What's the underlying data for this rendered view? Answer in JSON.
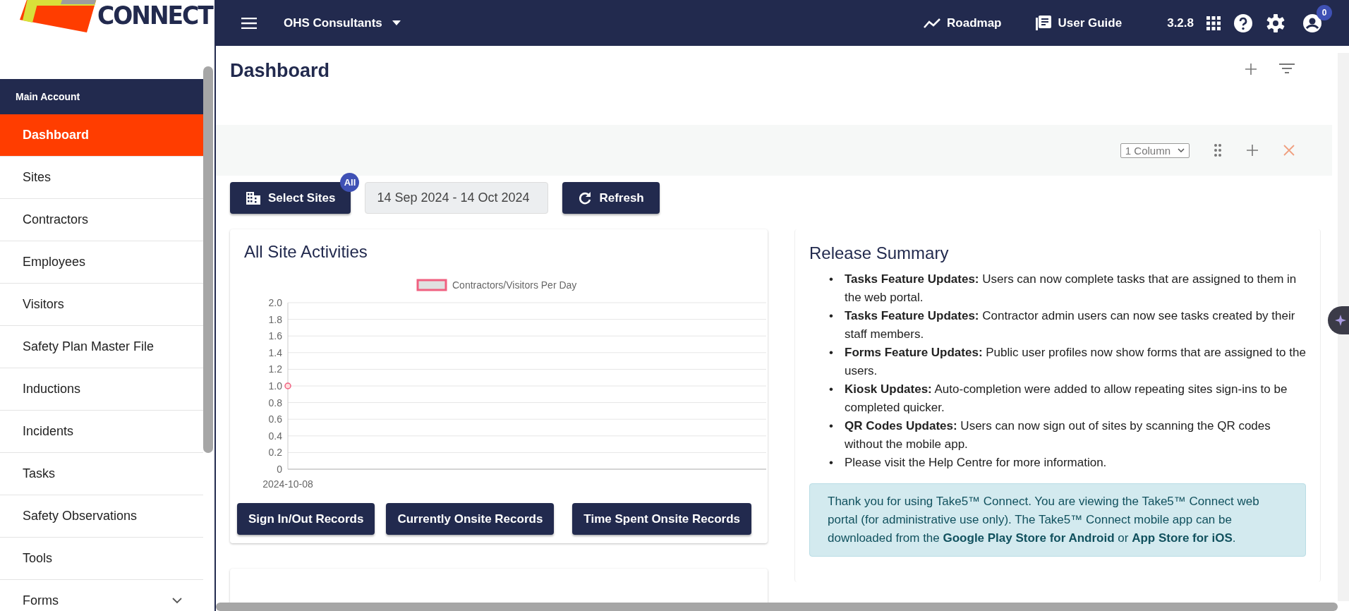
{
  "logo": {
    "text": "CONNECT"
  },
  "topbar": {
    "org": "OHS Consultants",
    "links": [
      {
        "kind": "roadmap",
        "label": "Roadmap"
      },
      {
        "kind": "guide",
        "label": "User Guide"
      }
    ],
    "version": "3.2.8",
    "notifications": "0"
  },
  "sidebar": {
    "section": "Main Account",
    "items": [
      {
        "label": "Dashboard",
        "selected": true,
        "expandable": false
      },
      {
        "label": "Sites",
        "selected": false,
        "expandable": false
      },
      {
        "label": "Contractors",
        "selected": false,
        "expandable": false
      },
      {
        "label": "Employees",
        "selected": false,
        "expandable": false
      },
      {
        "label": "Visitors",
        "selected": false,
        "expandable": false
      },
      {
        "label": "Safety Plan Master File",
        "selected": false,
        "expandable": false
      },
      {
        "label": "Inductions",
        "selected": false,
        "expandable": false
      },
      {
        "label": "Incidents",
        "selected": false,
        "expandable": false
      },
      {
        "label": "Tasks",
        "selected": false,
        "expandable": false
      },
      {
        "label": "Safety Observations",
        "selected": false,
        "expandable": false
      },
      {
        "label": "Tools",
        "selected": false,
        "expandable": false
      },
      {
        "label": "Forms",
        "selected": false,
        "expandable": true
      }
    ]
  },
  "page": {
    "title": "Dashboard",
    "layout_select": "1 Column"
  },
  "filters": {
    "select_sites": "Select Sites",
    "sites_badge": "All",
    "date_range": "14 Sep 2024 - 14 Oct 2024",
    "refresh": "Refresh"
  },
  "activities": {
    "title": "All Site Activities",
    "chart_data": {
      "type": "line",
      "categories": [
        "2024-10-08"
      ],
      "grid": true,
      "series": [
        {
          "name": "Contractors/Visitors Per Day",
          "color": "#f06080",
          "marker": true,
          "values": [
            1
          ]
        }
      ],
      "ylim": [
        0,
        2
      ],
      "yticks": [
        {
          "value": 0,
          "label": "0"
        },
        {
          "value": 0.2,
          "label": "0.2"
        },
        {
          "value": 0.4,
          "label": "0.4"
        },
        {
          "value": 0.6,
          "label": "0.6"
        },
        {
          "value": 0.8,
          "label": "0.8"
        },
        {
          "value": 1,
          "label": "1.0"
        },
        {
          "value": 1.2,
          "label": "1.2"
        },
        {
          "value": 1.4,
          "label": "1.4"
        },
        {
          "value": 1.6,
          "label": "1.6"
        },
        {
          "value": 1.8,
          "label": "1.8"
        },
        {
          "value": 2,
          "label": "2.0"
        }
      ]
    },
    "buttons": [
      "Sign In/Out Records",
      "Currently Onsite Records",
      "Time Spent Onsite Records"
    ]
  },
  "release": {
    "title": "Release Summary",
    "items": [
      {
        "marker": "•",
        "text": "**Tasks Feature Updates:** Users can now complete tasks that are assigned to them in the web portal."
      },
      {
        "marker": "•",
        "text": "**Tasks Feature Updates:** Contractor admin users can now see tasks created by their staff members."
      },
      {
        "marker": "•",
        "text": "**Forms Feature Updates:** Public user profiles now show forms that are assigned to the users."
      },
      {
        "marker": "•",
        "text": "**Kiosk Updates:** Auto-completion were added to allow repeating sites sign-ins to be completed quicker."
      },
      {
        "marker": "•",
        "text": "**QR Codes Updates:** Users can now sign out of sites by scanning the QR codes without the mobile app."
      },
      {
        "marker": "•",
        "text": "Please visit the Help Centre for more information."
      }
    ],
    "note": "Thank you for using Take5™ Connect. You are viewing the Take5™ Connect web portal (for administrative use only). The Take5™ Connect mobile app can be downloaded from the **Google Play Store for Android** or **App Store for iOS**."
  }
}
